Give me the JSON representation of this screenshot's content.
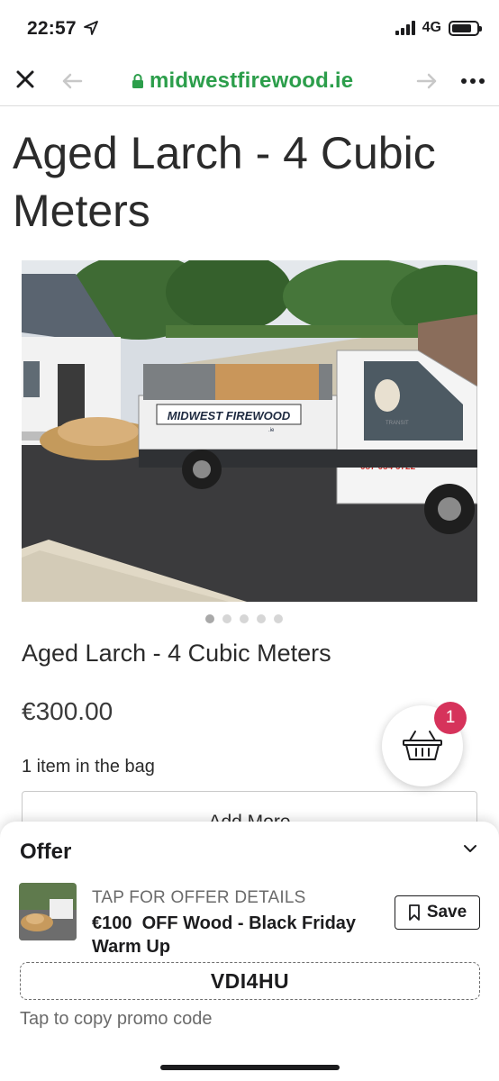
{
  "status_bar": {
    "time": "22:57",
    "network": "4G"
  },
  "browser": {
    "url": "midwestfirewood.ie"
  },
  "page": {
    "title": "Aged Larch - 4 Cubic Meters",
    "product_name": "Aged Larch - 4 Cubic Meters",
    "price": "€300.00",
    "bag_text": "1 item in the bag",
    "add_more_label": "Add More",
    "cart_count": "1",
    "carousel": {
      "total": 5,
      "active": 1
    },
    "hero_image": {
      "van_sign": "MIDWEST FIREWOOD",
      "van_sign_tld": ".ie",
      "van_phone": "087 054 6722",
      "van_model": "TRANSIT"
    }
  },
  "offer": {
    "title": "Offer",
    "tap_label": "TAP FOR OFFER DETAILS",
    "headline": "€100  OFF Wood - Black Friday Warm Up",
    "save_label": "Save",
    "promo_code": "VDI4HU",
    "copy_hint": "Tap to copy promo code"
  },
  "colors": {
    "url_green": "#2c9e4b",
    "badge_pink": "#d6335b"
  }
}
